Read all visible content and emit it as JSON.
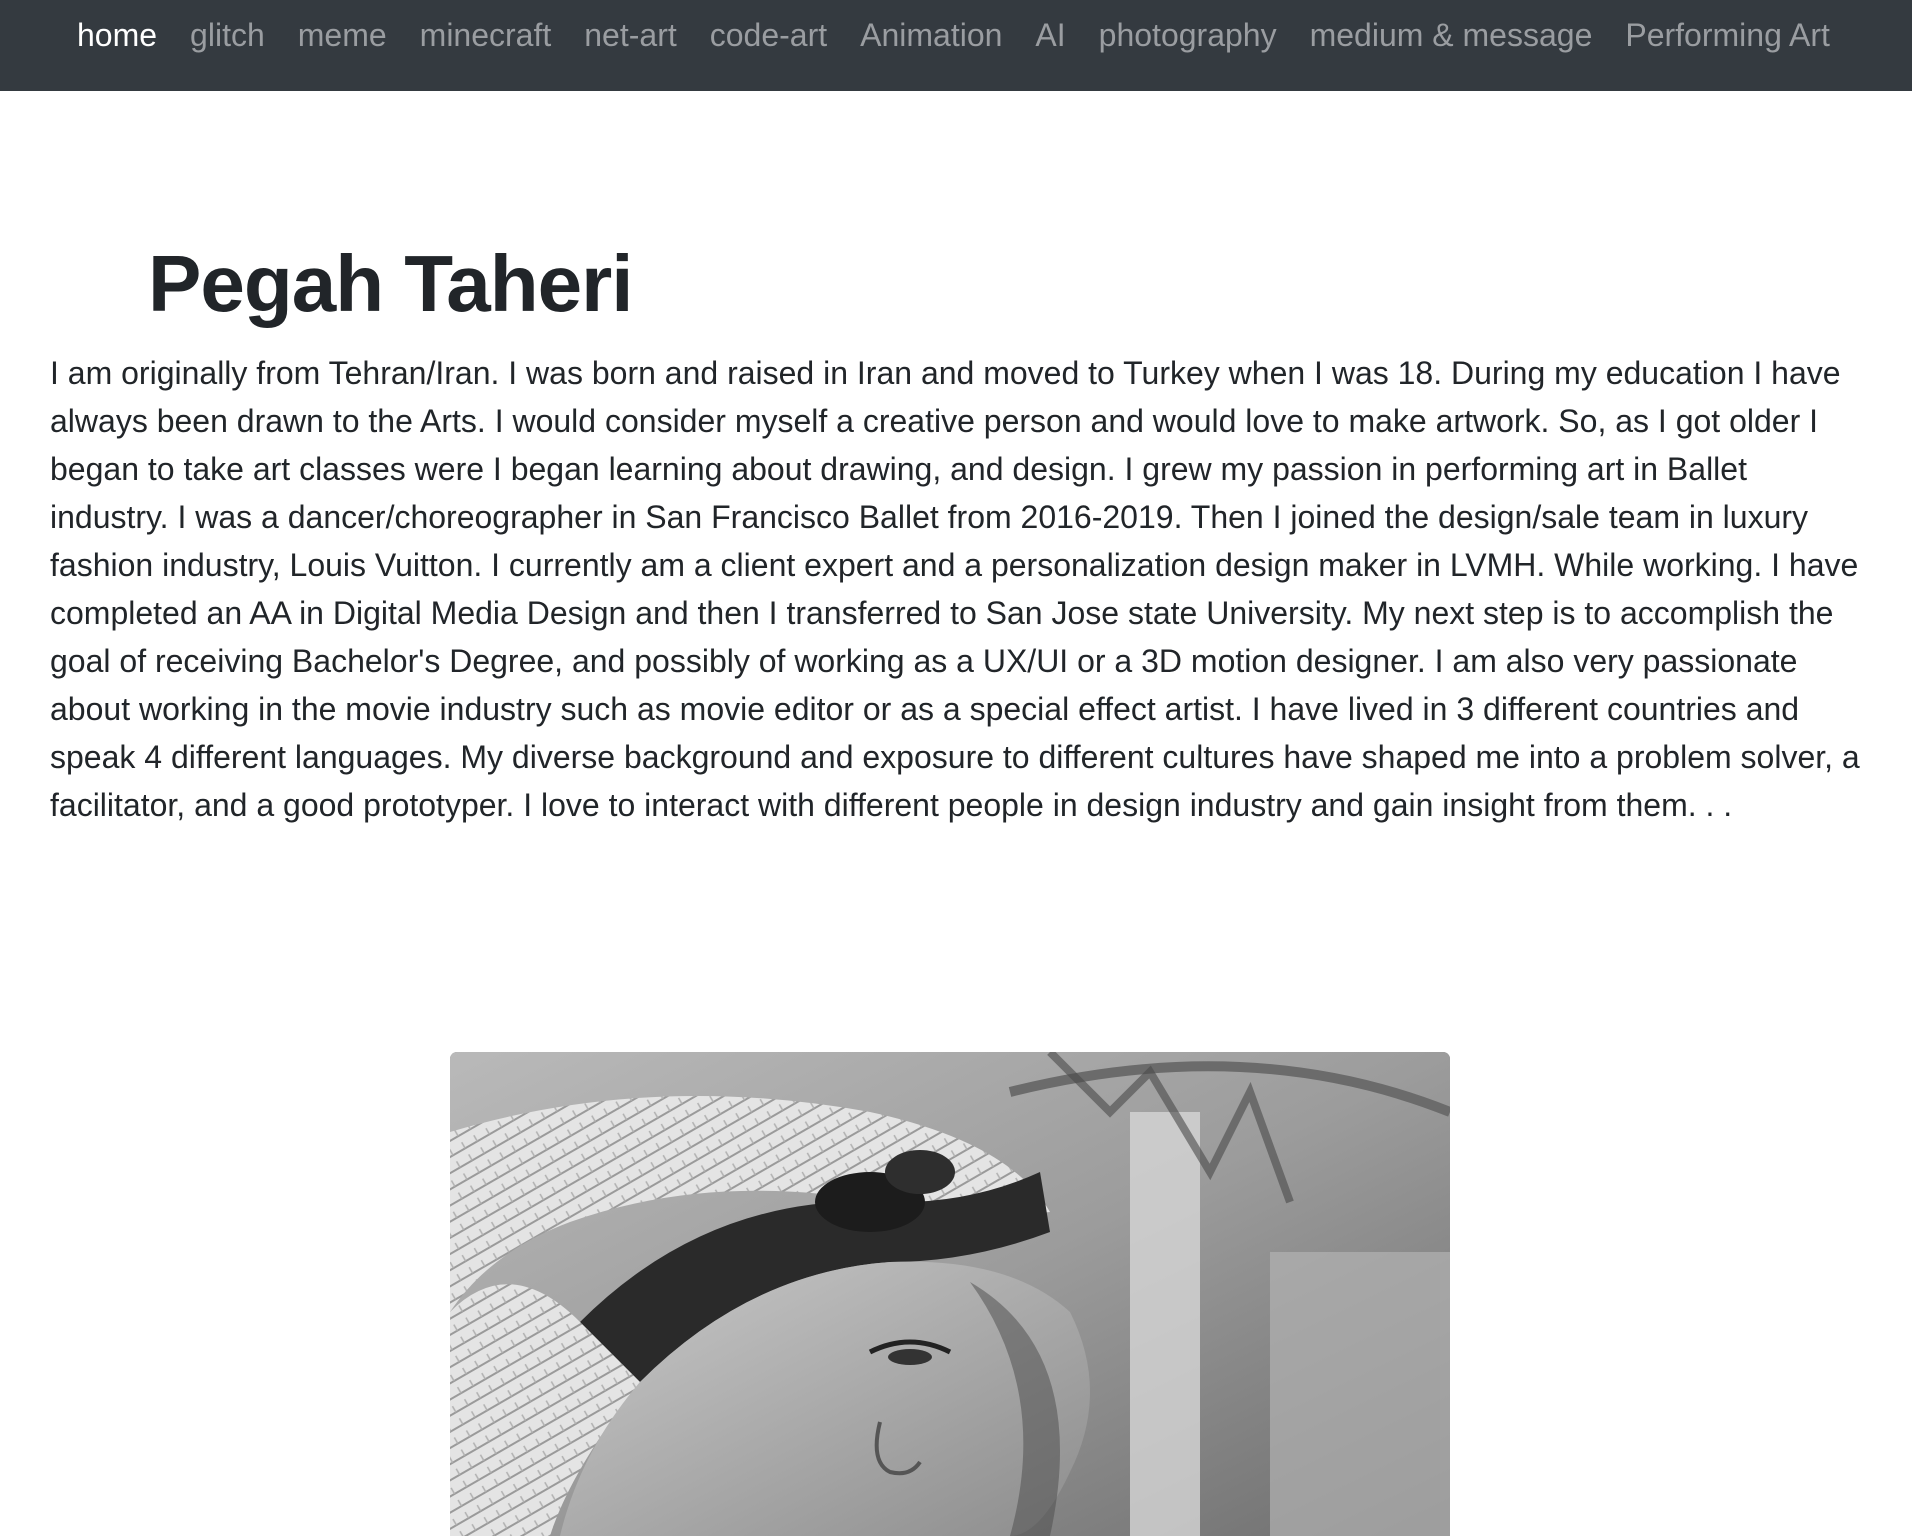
{
  "nav": {
    "items": [
      {
        "label": "home",
        "active": true
      },
      {
        "label": "glitch"
      },
      {
        "label": "meme"
      },
      {
        "label": "minecraft"
      },
      {
        "label": "net-art"
      },
      {
        "label": "code-art"
      },
      {
        "label": "Animation"
      },
      {
        "label": "AI"
      },
      {
        "label": "photography"
      },
      {
        "label": "medium & message"
      },
      {
        "label": "Performing Art"
      }
    ]
  },
  "main": {
    "title": "Pegah Taheri",
    "bio": "I am originally from Tehran/Iran. I was born and raised in Iran and moved to Turkey when I was 18. During my education I have always been drawn to the Arts. I would consider myself a creative person and would love to make artwork. So, as I got older I began to take art classes were I began learning about drawing, and design. I grew my passion in performing art in Ballet industry. I was a dancer/choreographer in San Francisco Ballet from 2016-2019. Then I joined the design/sale team in luxury fashion industry, Louis Vuitton. I currently am a client expert and a personalization design maker in LVMH. While working. I have completed an AA in Digital Media Design and then I transferred to San Jose state University. My next step is to accomplish the goal of receiving Bachelor's Degree, and possibly of working as a UX/UI or a 3D motion designer. I am also very passionate about working in the movie industry such as movie editor or as a special effect artist. I have lived in 3 different countries and speak 4 different languages. My diverse background and exposure to different cultures have shaped me into a problem solver, a facilitator, and a good prototyper. I love to interact with different people in design industry and gain insight from them. . .",
    "photo": {
      "style": "black-and-white portrait, woman in straw hat"
    }
  },
  "colors": {
    "navbar_bg": "#343a40",
    "nav_active": "#ffffff",
    "nav_inactive": "#9a9da1",
    "text": "#212529"
  }
}
